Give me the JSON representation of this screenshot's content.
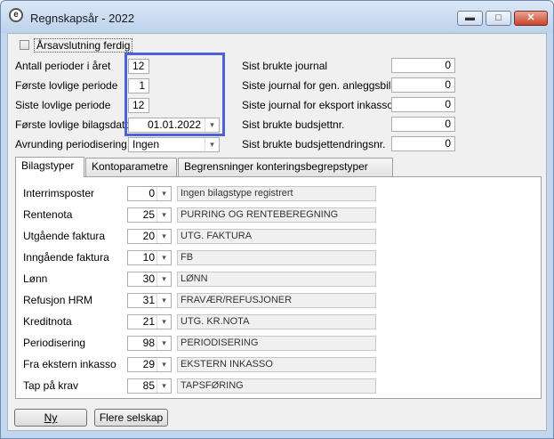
{
  "window": {
    "title": "Regnskapsår - 2022",
    "icon": "app-logo-icon"
  },
  "header": {
    "checkbox_label": "Årsavslutning ferdig",
    "left_fields": [
      {
        "label": "Antall perioder i året",
        "value": "12"
      },
      {
        "label": "Første lovlige periode",
        "value": "1"
      },
      {
        "label": "Siste lovlige periode",
        "value": "12"
      },
      {
        "label": "Første lovlige bilagsdato",
        "value": "01.01.2022"
      },
      {
        "label": "Avrunding periodisering",
        "value": "Ingen"
      }
    ],
    "right_fields": [
      {
        "label": "Sist brukte journal",
        "value": "0"
      },
      {
        "label": "Siste journal for gen. anleggsbilag",
        "value": "0"
      },
      {
        "label": "Siste journal for eksport inkasso",
        "value": "0"
      },
      {
        "label": "Sist brukte budsjettnr.",
        "value": "0"
      },
      {
        "label": "Sist brukte budsjettendringsnr.",
        "value": "0"
      }
    ]
  },
  "tabs": [
    {
      "label": "Bilagstyper",
      "active": true
    },
    {
      "label": "Kontoparametre",
      "active": false
    },
    {
      "label": "Begrensninger konteringsbegrepstyper",
      "active": false
    }
  ],
  "bilagstyper": [
    {
      "label": "Interrimsposter",
      "num": "0",
      "desc": "Ingen bilagstype registrert"
    },
    {
      "label": "Rentenota",
      "num": "25",
      "desc": "PURRING OG RENTEBEREGNING"
    },
    {
      "label": "Utgående faktura",
      "num": "20",
      "desc": "UTG. FAKTURA"
    },
    {
      "label": "Inngående faktura",
      "num": "10",
      "desc": "FB"
    },
    {
      "label": "Lønn",
      "num": "30",
      "desc": "LØNN"
    },
    {
      "label": "Refusjon HRM",
      "num": "31",
      "desc": "FRAVÆR/REFUSJONER"
    },
    {
      "label": "Kreditnota",
      "num": "21",
      "desc": "UTG. KR.NOTA"
    },
    {
      "label": "Periodisering",
      "num": "98",
      "desc": "PERIODISERING"
    },
    {
      "label": "Fra ekstern inkasso",
      "num": "29",
      "desc": "EKSTERN INKASSO"
    },
    {
      "label": "Tap på krav",
      "num": "85",
      "desc": "TAPSFØRING"
    }
  ],
  "buttons": {
    "new_label": "Ny",
    "more_label": "Flere selskap"
  },
  "colors": {
    "highlight": "#4a63d6",
    "titlebar": "#c2d7ef"
  }
}
